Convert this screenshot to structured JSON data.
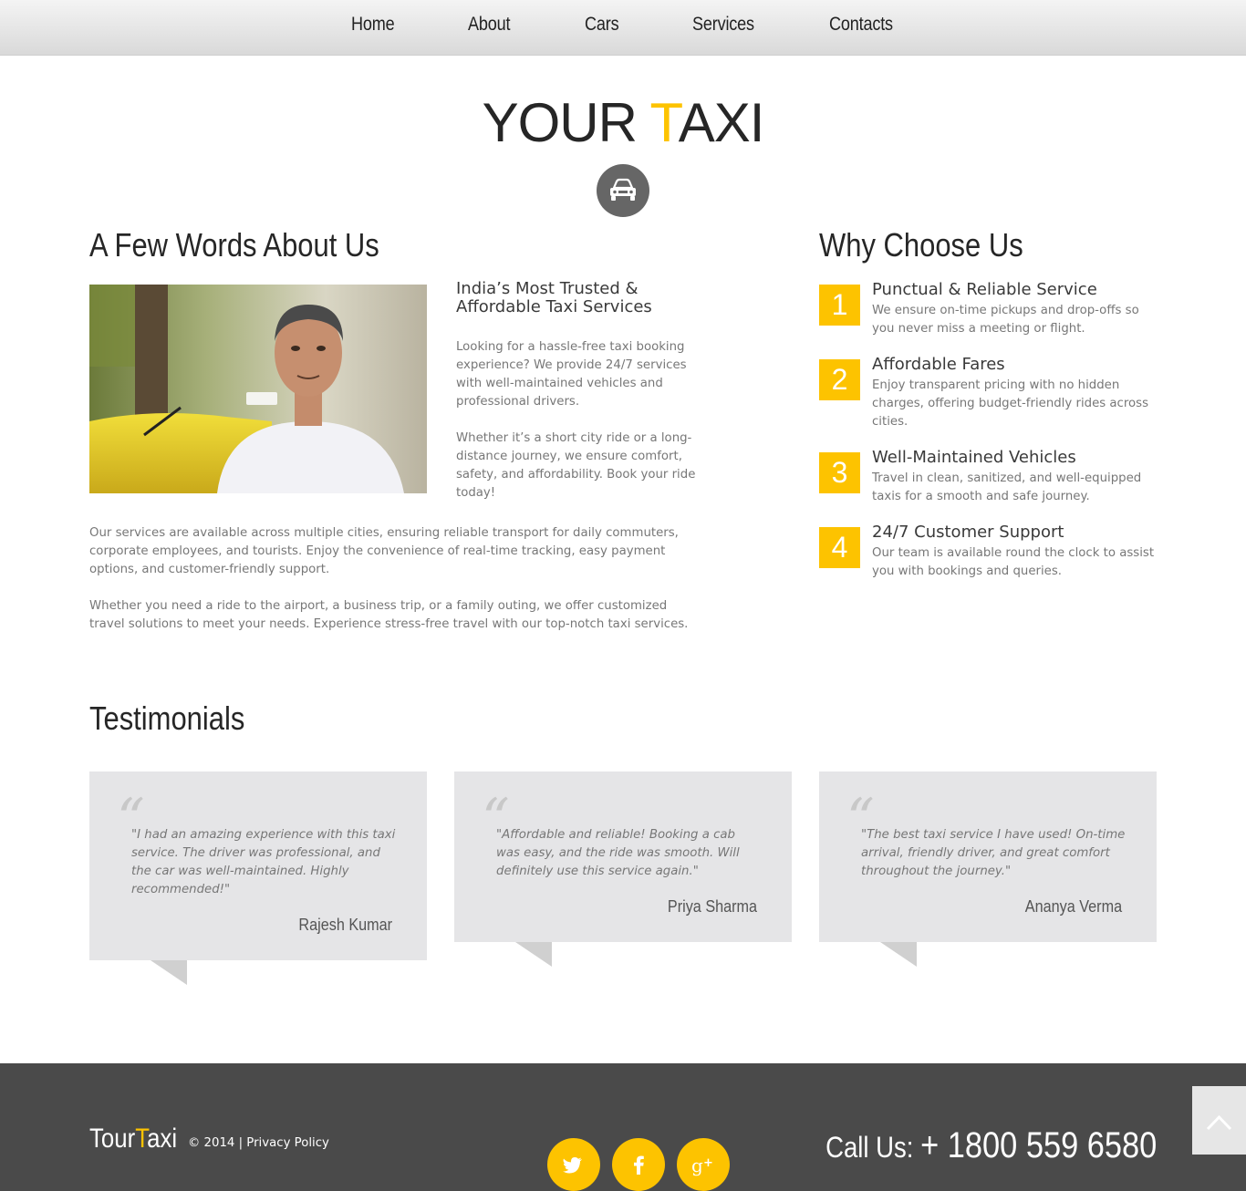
{
  "nav": {
    "items": [
      "Home",
      "About",
      "Cars",
      "Services",
      "Contacts"
    ]
  },
  "logo": {
    "part1": "YOUR ",
    "highlight": "T",
    "part2": "AXI",
    "icon": "car-icon"
  },
  "about": {
    "heading": "A Few Words About Us",
    "image": "taxi-driver-photo",
    "subtitle": "India’s Most Trusted & Affordable Taxi Services",
    "p1": "Looking for a hassle-free taxi booking experience? We provide 24/7 services with well-maintained vehicles and professional drivers.",
    "p2": "Whether it’s a short city ride or a long-distance journey, we ensure comfort, safety, and affordability. Book your ride today!",
    "p3": "Our services are available across multiple cities, ensuring reliable transport for daily commuters, corporate employees, and tourists. Enjoy the convenience of real-time tracking, easy payment options, and customer-friendly support.",
    "p4": "Whether you need a ride to the airport, a business trip, or a family outing, we offer customized travel solutions to meet your needs. Experience stress-free travel with our top-notch taxi services."
  },
  "why": {
    "heading": "Why Choose Us",
    "items": [
      {
        "num": "1",
        "title": "Punctual & Reliable Service",
        "text": "We ensure on-time pickups and drop-offs so you never miss a meeting or flight."
      },
      {
        "num": "2",
        "title": "Affordable Fares",
        "text": "Enjoy transparent pricing with no hidden charges, offering budget-friendly rides across cities."
      },
      {
        "num": "3",
        "title": "Well-Maintained Vehicles",
        "text": "Travel in clean, sanitized, and well-equipped taxis for a smooth and safe journey."
      },
      {
        "num": "4",
        "title": "24/7 Customer Support",
        "text": "Our team is available round the clock to assist you with bookings and queries."
      }
    ]
  },
  "testimonials": {
    "heading": "Testimonials",
    "quote_mark": "“",
    "items": [
      {
        "text": "\"I had an amazing experience with this taxi service. The driver was professional, and the car was well-maintained. Highly recommended!\"",
        "author": "Rajesh Kumar"
      },
      {
        "text": "\"Affordable and reliable! Booking a cab was easy, and the ride was smooth. Will definitely use this service again.\"",
        "author": "Priya Sharma"
      },
      {
        "text": "\"The best taxi service I have used! On-time arrival, friendly driver, and great comfort throughout the journey.\"",
        "author": "Ananya Verma"
      }
    ]
  },
  "footer": {
    "brand1": "Tour",
    "brand_highlight": "T",
    "brand2": "axi",
    "copy": "© 2014 | ",
    "privacy": "Privacy Policy",
    "social": [
      "twitter-icon",
      "facebook-icon",
      "google-plus-icon"
    ],
    "call_label": "Call Us: ",
    "call_number": "+ 1800 559 6580",
    "to_top_icon": "chevron-up-icon"
  },
  "colors": {
    "accent": "#fdc300",
    "footer_bg": "#4a4a4a",
    "card_bg": "#e5e5e7"
  }
}
